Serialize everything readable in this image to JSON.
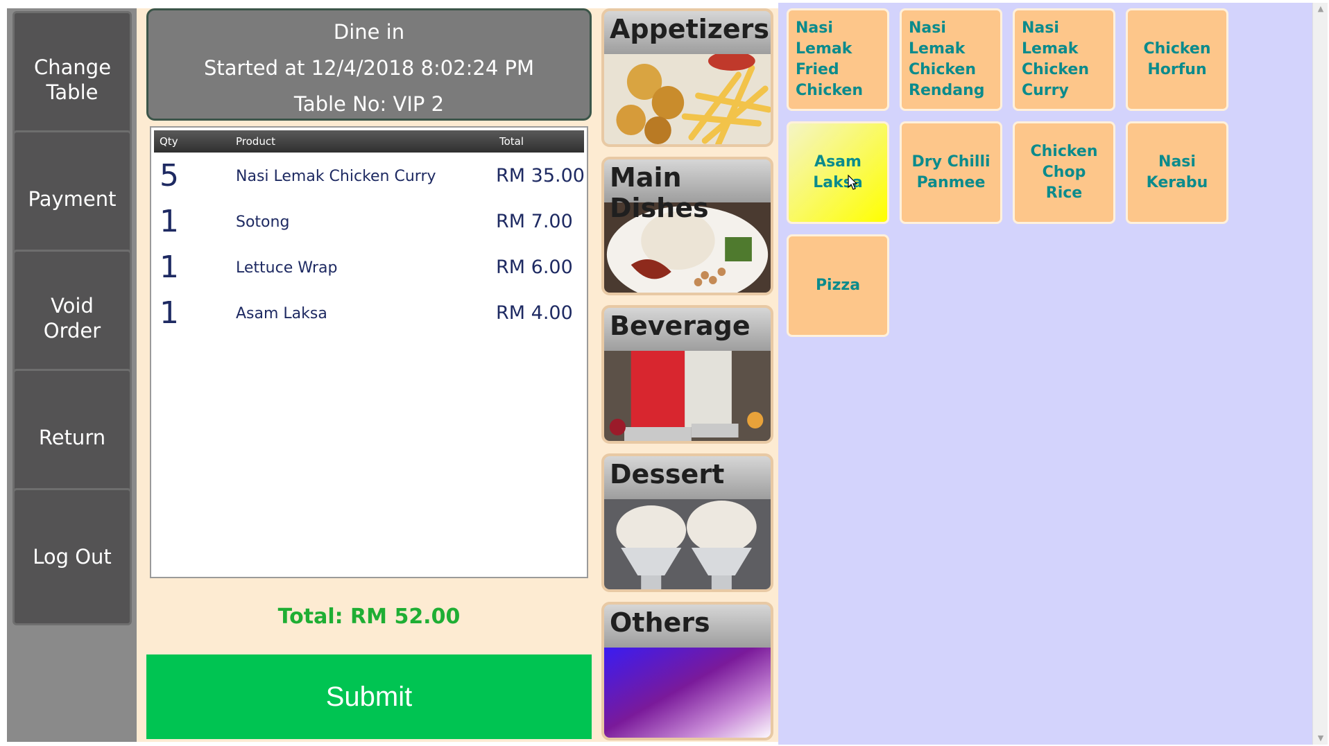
{
  "actions": {
    "change_table": "Change Table",
    "payment": "Payment",
    "void_order": "Void Order",
    "return": "Return",
    "log_out": "Log Out"
  },
  "order_header": {
    "mode": "Dine in",
    "started": "Started at 12/4/2018 8:02:24 PM",
    "table": "Table No: VIP 2"
  },
  "order_table": {
    "columns": {
      "qty": "Qty",
      "product": "Product",
      "total": "Total"
    },
    "rows": [
      {
        "qty": "5",
        "product": "Nasi Lemak Chicken Curry",
        "total": "RM 35.00"
      },
      {
        "qty": "1",
        "product": "Sotong",
        "total": "RM 7.00"
      },
      {
        "qty": "1",
        "product": "Lettuce Wrap",
        "total": "RM 6.00"
      },
      {
        "qty": "1",
        "product": "Asam Laksa",
        "total": "RM 4.00"
      }
    ]
  },
  "order_total": "Total: RM 52.00",
  "submit_label": "Submit",
  "categories": [
    {
      "label": "Appetizers",
      "icon": "appetizers-image"
    },
    {
      "label": "Main Dishes",
      "icon": "main-dishes-image"
    },
    {
      "label": "Beverage",
      "icon": "beverage-image"
    },
    {
      "label": "Dessert",
      "icon": "dessert-image"
    },
    {
      "label": "Others",
      "icon": "others-gradient-image"
    }
  ],
  "products": [
    {
      "label": "Nasi Lemak Fried Chicken"
    },
    {
      "label": "Nasi Lemak Chicken Rendang"
    },
    {
      "label": "Nasi Lemak Chicken Curry"
    },
    {
      "label": "Chicken Horfun"
    },
    {
      "label": "Asam Laksa"
    },
    {
      "label": "Dry Chilli Panmee"
    },
    {
      "label": "Chicken Chop Rice"
    },
    {
      "label": "Nasi Kerabu"
    },
    {
      "label": "Pizza"
    }
  ],
  "colors": {
    "action_button": "#545354",
    "panel_bg": "#fdebd2",
    "product_bg": "#fdc68a",
    "product_text": "#0b8b8c",
    "product_area_bg": "#d3d3fc",
    "submit_bg": "#00c452",
    "total_text": "#1fae34",
    "highlighted_product": "#ffff00"
  }
}
